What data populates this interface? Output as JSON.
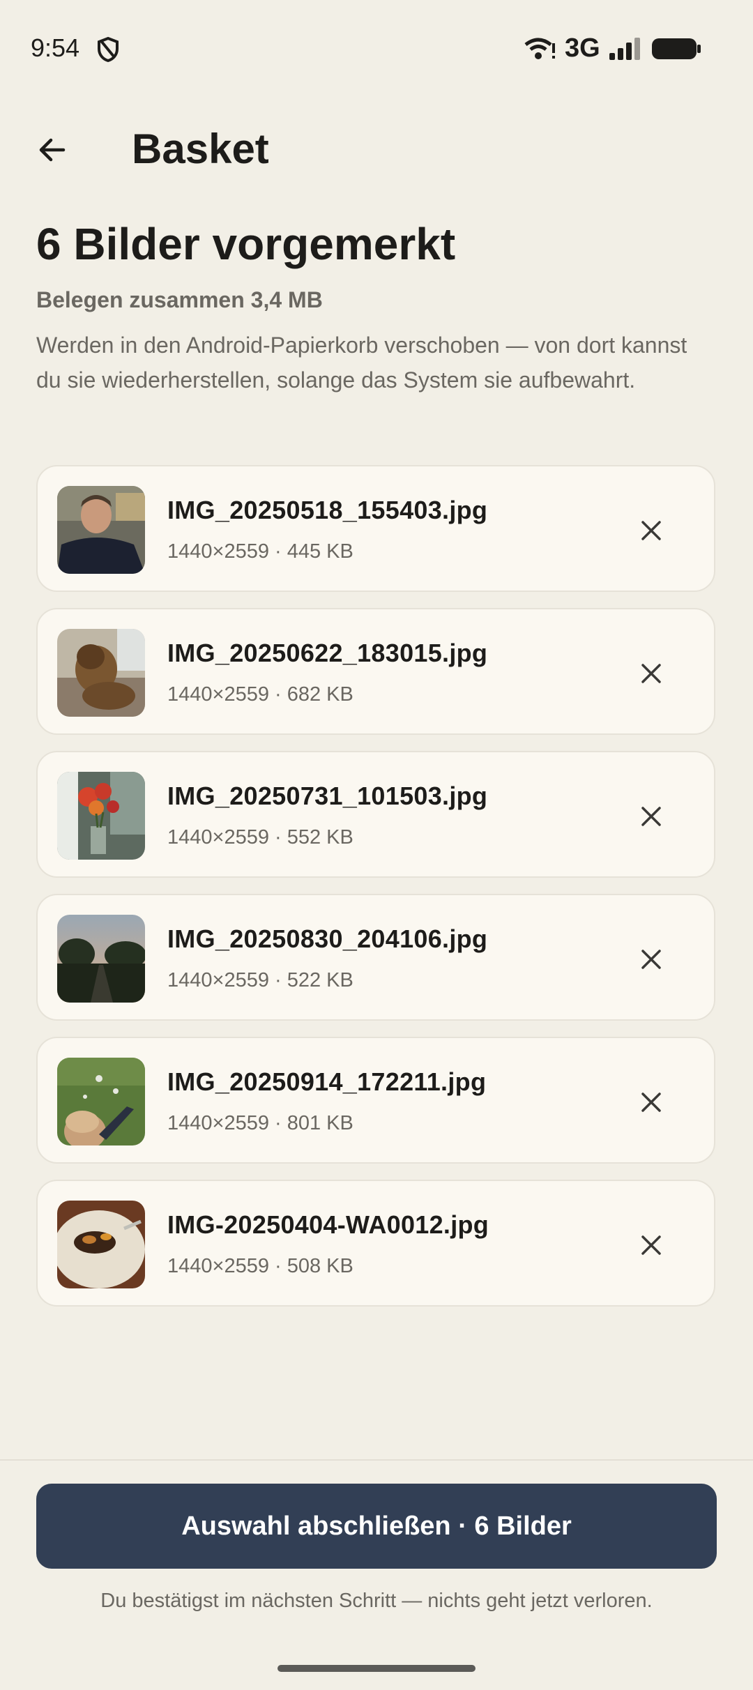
{
  "status_bar": {
    "time": "9:54",
    "network": "3G"
  },
  "header": {
    "title": "Basket"
  },
  "main": {
    "title": "6 Bilder vorgemerkt",
    "size_summary": "Belegen zusammen 3,4 MB",
    "description": "Werden in den Android-Papierkorb verschoben — von dort kannst du sie wiederherstellen, solange das System sie aufbewahrt."
  },
  "files": [
    {
      "name": "IMG_20250518_155403.jpg",
      "meta": "1440×2559 · 445 KB"
    },
    {
      "name": "IMG_20250622_183015.jpg",
      "meta": "1440×2559 · 682 KB"
    },
    {
      "name": "IMG_20250731_101503.jpg",
      "meta": "1440×2559 · 552 KB"
    },
    {
      "name": "IMG_20250830_204106.jpg",
      "meta": "1440×2559 · 522 KB"
    },
    {
      "name": "IMG_20250914_172211.jpg",
      "meta": "1440×2559 · 801 KB"
    },
    {
      "name": "IMG-20250404-WA0012.jpg",
      "meta": "1440×2559 · 508 KB"
    }
  ],
  "footer": {
    "confirm_label": "Auswahl abschließen · 6 Bilder",
    "note": "Du bestätigst im nächsten Schritt — nichts geht jetzt verloren."
  },
  "colors": {
    "background": "#f2efe6",
    "card": "#fbf8f1",
    "primary_button": "#323f55"
  }
}
